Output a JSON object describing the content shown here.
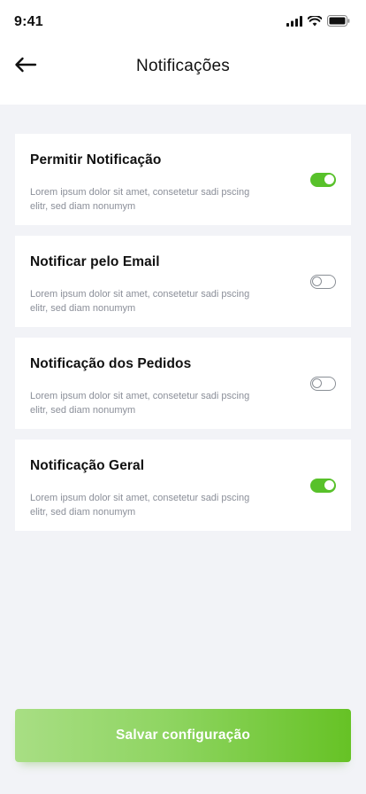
{
  "status_bar": {
    "time": "9:41",
    "icons": [
      "signal-icon",
      "wifi-icon",
      "battery-icon"
    ]
  },
  "header": {
    "back_icon": "arrow-left-icon",
    "title": "Notificações"
  },
  "settings": [
    {
      "title": "Permitir Notificação",
      "description": "Lorem ipsum dolor sit amet, consetetur sadi pscing elitr, sed diam nonumym",
      "enabled": true
    },
    {
      "title": "Notificar pelo Email",
      "description": "Lorem ipsum dolor sit amet, consetetur sadi pscing elitr, sed diam nonumym",
      "enabled": false
    },
    {
      "title": "Notificação dos Pedidos",
      "description": "Lorem ipsum dolor sit amet, consetetur sadi pscing elitr, sed diam nonumym",
      "enabled": false
    },
    {
      "title": "Notificação Geral",
      "description": "Lorem ipsum dolor sit amet, consetetur sadi pscing elitr, sed diam nonumym",
      "enabled": true
    }
  ],
  "footer": {
    "save_label": "Salvar configuração"
  },
  "colors": {
    "accent": "#58c12a",
    "background": "#f2f3f7",
    "card": "#ffffff",
    "muted_text": "#8b8f99"
  }
}
